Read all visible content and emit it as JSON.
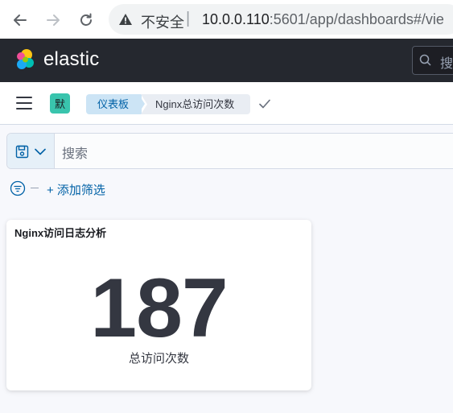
{
  "browser": {
    "security_label": "不安全",
    "url_host": "10.0.0.110",
    "url_rest": ":5601/app/dashboards#/vie"
  },
  "header": {
    "logo_text": "elastic",
    "global_search_placeholder": "搜"
  },
  "breadcrumbs": {
    "space_initial": "默",
    "items": [
      "仪表板",
      "Nginx总访问次数"
    ]
  },
  "query_bar": {
    "placeholder": "搜索"
  },
  "filters": {
    "add_label": "+ 添加筛选"
  },
  "panel": {
    "title": "Nginx访问日志分析",
    "metric_value": "187",
    "metric_label": "总访问次数"
  },
  "colors": {
    "header_bg": "#25282f",
    "accent_link": "#0061a6",
    "space_avatar": "#39c4ad"
  }
}
